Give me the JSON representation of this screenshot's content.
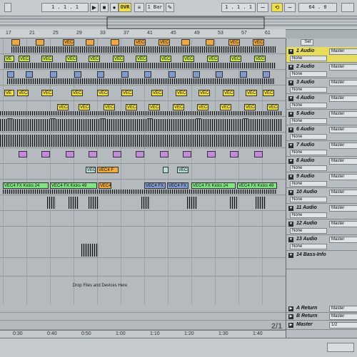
{
  "transport": {
    "position": "1 .   1 .   1",
    "overdub": "OVR",
    "quantize": "1 Bar",
    "loop_start": "1 .   1 .   1",
    "punch_value": "64 .   0"
  },
  "ruler": {
    "bars": [
      "17",
      "21",
      "25",
      "29",
      "33",
      "37",
      "41",
      "45",
      "49",
      "53",
      "57",
      "61"
    ]
  },
  "timeline": {
    "times": [
      "0:30",
      "0:40",
      "0:50",
      "1:00",
      "1:10",
      "1:20",
      "1:30",
      "1:40"
    ]
  },
  "clips": {
    "label_short": "VEC4",
    "label_short_alt": "VE",
    "fx_kicks_24": "VEC4 FX Kicks 24",
    "fx_kicks_49": "VEC4 FX Kicks 49",
    "fx_short": "VEC4 FX",
    "vec4_fx_alt": "VEC4 FX",
    "vec4_f": "VEC4 F"
  },
  "drop_hint": "Drop Files and Devices Here",
  "page_indicator": "2/1",
  "mixer": {
    "set_label": "Set",
    "tracks": [
      {
        "name": "1 Audio",
        "output": "Master",
        "input": "None",
        "highlight": true
      },
      {
        "name": "2 Audio",
        "output": "Master",
        "input": "None"
      },
      {
        "name": "3 Audio",
        "output": "Master",
        "input": "None"
      },
      {
        "name": "4 Audio",
        "output": "Master",
        "input": "None"
      },
      {
        "name": "5 Audio",
        "output": "Master",
        "input": "None"
      },
      {
        "name": "6 Audio",
        "output": "Master",
        "input": "None"
      },
      {
        "name": "7 Audio",
        "output": "Master",
        "input": "None"
      },
      {
        "name": "8 Audio",
        "output": "Master",
        "input": "None"
      },
      {
        "name": "9 Audio",
        "output": "Master",
        "input": "None"
      },
      {
        "name": "10 Audio",
        "output": "Master",
        "input": "None"
      },
      {
        "name": "11 Audio",
        "output": "Master",
        "input": "None"
      },
      {
        "name": "12 Audio",
        "output": "Master",
        "input": "None"
      },
      {
        "name": "13 Audio",
        "output": "Master",
        "input": "None"
      },
      {
        "name": "14 Bass-Info",
        "output": "",
        "input": ""
      }
    ],
    "returns": [
      {
        "name": "A Return",
        "output": "Master"
      },
      {
        "name": "B Return",
        "output": "Master"
      }
    ],
    "master": {
      "name": "Master",
      "output": "1/2"
    }
  },
  "colors": {
    "yellow": "#f2e13a",
    "lime": "#c5e94d",
    "blue_steel": "#7f9bd1",
    "purple": "#c58ae0",
    "green": "#7ee67e",
    "orange": "#f3a93a",
    "seafoam": "#b7ddd2"
  }
}
